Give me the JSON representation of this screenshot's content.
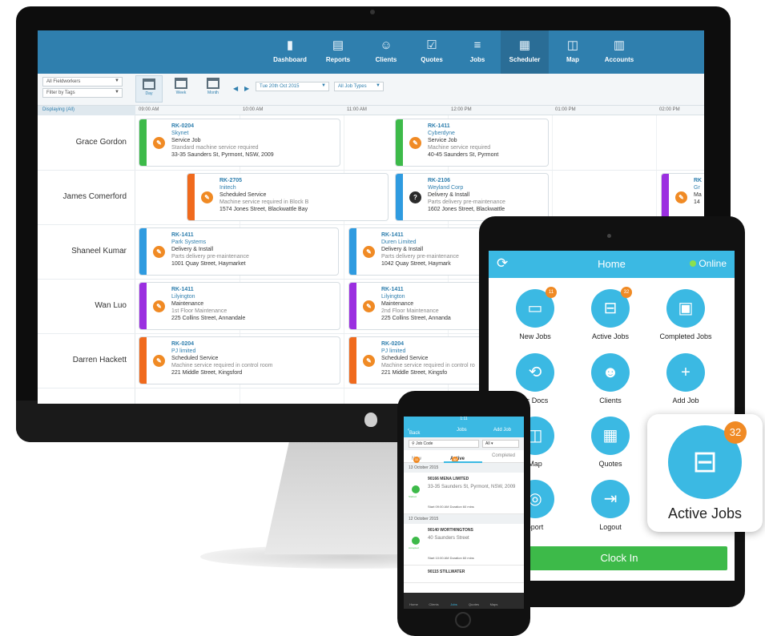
{
  "desktop": {
    "nav": [
      {
        "label": "Dashboard",
        "icon": "bar-chart-icon"
      },
      {
        "label": "Reports",
        "icon": "document-icon"
      },
      {
        "label": "Clients",
        "icon": "clients-icon"
      },
      {
        "label": "Quotes",
        "icon": "clipboard-icon"
      },
      {
        "label": "Jobs",
        "icon": "list-icon"
      },
      {
        "label": "Scheduler",
        "icon": "calendar-icon"
      },
      {
        "label": "Map",
        "icon": "map-icon"
      },
      {
        "label": "Accounts",
        "icon": "accounts-icon"
      }
    ],
    "active_nav": "Scheduler",
    "filters": {
      "fieldworkers": "All Fieldworkers",
      "tags": "Filter by Tags"
    },
    "views": [
      "Day",
      "Week",
      "Month"
    ],
    "active_view": "Day",
    "date": "Tue 20th Oct 2015",
    "job_types": "All Job Types",
    "displaying": "Displaying (All)",
    "times": [
      "09:00 AM",
      "10:00 AM",
      "11:00 AM",
      "12:00 PM",
      "01:00 PM",
      "02:00 PM"
    ],
    "workers": [
      "Grace Gordon",
      "James Comerford",
      "Shaneel Kumar",
      "Wan Luo",
      "Darren Hackett"
    ],
    "jobs": [
      {
        "id": "RK-0204",
        "company": "Skynet",
        "type": "Service Job",
        "desc": "Standard machine service required",
        "address": "33-35 Saunders St, Pyrmont, NSW, 2009",
        "color": "#3dba49"
      },
      {
        "id": "RK-1411",
        "company": "Cyberdyne",
        "type": "Service Job",
        "desc": "Machine service required",
        "address": "40-45 Saunders St, Pyrmont",
        "color": "#3dba49"
      },
      {
        "id": "RK-2705",
        "company": "Initech",
        "type": "Scheduled Service",
        "desc": "Machine service required in Block B",
        "address": "1574 Jones Street, Blackwattle Bay",
        "color": "#f06a1d"
      },
      {
        "id": "RK-2106",
        "company": "Weyland Corp",
        "type": "Delivery & Install",
        "desc": "Parts delivery pre-maintenance",
        "address": "1602 Jones Street, Blackwattle",
        "color": "#2f9be0"
      },
      {
        "id": "RK",
        "company": "Gr",
        "type": "Ma",
        "desc": "",
        "address": "14",
        "color": "#9b2fe0"
      },
      {
        "id": "RK-1411",
        "company": "Park Systems",
        "type": "Delivery & Install",
        "desc": "Parts delivery pre-maintenance",
        "address": "1001 Quay Street, Haymarket",
        "color": "#2f9be0"
      },
      {
        "id": "RK-1411",
        "company": "Duren Limited",
        "type": "Delivery & Install",
        "desc": "Parts delivery pre-maintenance",
        "address": "1042 Quay Street, Haymark",
        "color": "#2f9be0"
      },
      {
        "id": "RK-1411",
        "company": "Lilyington",
        "type": "Maintenance",
        "desc": "1st Floor Maintenance",
        "address": "225 Collins Street, Annandale",
        "color": "#9b2fe0"
      },
      {
        "id": "RK-1411",
        "company": "Lilyington",
        "type": "Maintenance",
        "desc": "2nd Floor Maintenance",
        "address": "225 Collins Street, Annanda",
        "color": "#9b2fe0"
      },
      {
        "id": "RK-0204",
        "company": "PJ limited",
        "type": "Scheduled Service",
        "desc": "Machine service required in control room",
        "address": "221 Middle Street, Kingsford",
        "color": "#f06a1d"
      },
      {
        "id": "RK-0204",
        "company": "PJ limited",
        "type": "Scheduled Service",
        "desc": "Machine service required in control ro",
        "address": "221 Middle Street, Kingsfo",
        "color": "#f06a1d"
      }
    ]
  },
  "tablet": {
    "title": "Home",
    "status": "Online",
    "tiles": [
      {
        "label": "New Jobs",
        "badge": "11",
        "icon": "inbox-icon"
      },
      {
        "label": "Active Jobs",
        "badge": "32",
        "icon": "tray-icon"
      },
      {
        "label": "Completed Jobs",
        "badge": "",
        "icon": "archive-icon"
      },
      {
        "label": "nc Docs",
        "badge": "",
        "icon": "sync-icon"
      },
      {
        "label": "Clients",
        "badge": "",
        "icon": "people-icon"
      },
      {
        "label": "Add Job",
        "badge": "",
        "icon": "plus-icon"
      },
      {
        "label": "Map",
        "badge": "",
        "icon": "map-icon"
      },
      {
        "label": "Quotes",
        "badge": "",
        "icon": "calculator-icon"
      },
      {
        "label": "pport",
        "badge": "",
        "icon": "lifebuoy-icon"
      },
      {
        "label": "Logout",
        "badge": "",
        "icon": "logout-icon"
      }
    ],
    "clock_in": "Clock In"
  },
  "callout": {
    "label": "Active Jobs",
    "badge": "32"
  },
  "phone": {
    "time": "1:11",
    "back": "Back",
    "title": "Jobs",
    "add": "Add Job",
    "search_placeholder": "Job Code",
    "filter": "All",
    "tabs": [
      {
        "label": "New",
        "badge": "11"
      },
      {
        "label": "Active",
        "badge": "32"
      },
      {
        "label": "Completed",
        "badge": ""
      }
    ],
    "groups": [
      {
        "date": "13 October 2015",
        "items": [
          {
            "title": "90166 MENA LIMITED",
            "address": "33-35 Saunders St, Pyrmont, NSW, 2009",
            "status": "Started",
            "meta": "Start 09:00 AM  Duration 60 mins"
          }
        ]
      },
      {
        "date": "12 October 2015",
        "items": [
          {
            "title": "90140 WORTHINGTONS",
            "address": "40 Saunders Street",
            "status": "Accepted",
            "meta": "Start 10:00 AM  Duration 60 mins"
          },
          {
            "title": "90115 STILLWATER",
            "address": "",
            "status": "",
            "meta": ""
          }
        ]
      }
    ],
    "tabbar": [
      "Home",
      "Clients",
      "Jobs",
      "Quotes",
      "Maps"
    ]
  }
}
